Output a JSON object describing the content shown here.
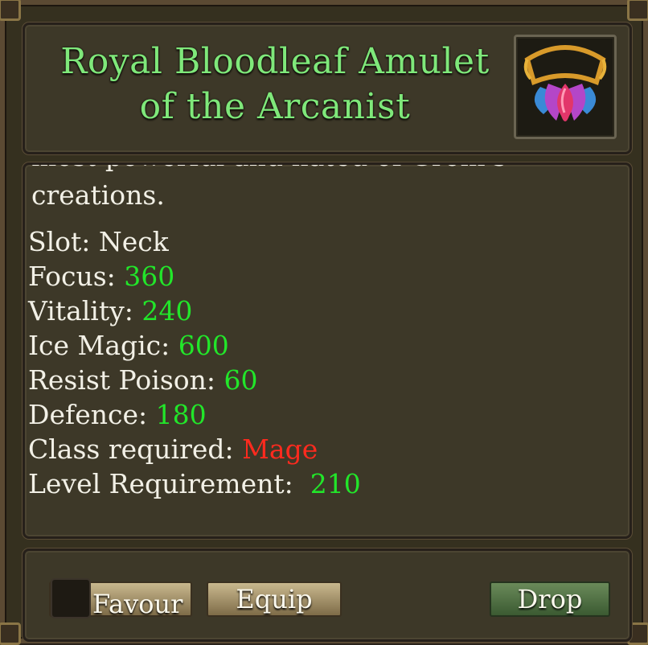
{
  "item": {
    "name_line1": "Royal Bloodleaf Amulet",
    "name_line2": "of the Arcanist",
    "icon": "amulet-icon",
    "description_cut": "most powerful and hated of Grom's",
    "description_end": "creations."
  },
  "stats": [
    {
      "label": "Slot: ",
      "value": "Neck",
      "color": "#f2f0e6"
    },
    {
      "label": "Focus: ",
      "value": "360",
      "color": "#22e62a"
    },
    {
      "label": "Vitality: ",
      "value": "240",
      "color": "#22e62a"
    },
    {
      "label": "Ice Magic: ",
      "value": "600",
      "color": "#22e62a"
    },
    {
      "label": "Resist Poison: ",
      "value": "60",
      "color": "#22e62a"
    },
    {
      "label": "Defence: ",
      "value": "180",
      "color": "#22e62a"
    },
    {
      "label": "Class required: ",
      "value": "Mage",
      "color": "#ff2a1e"
    },
    {
      "label": "Level Requirement:  ",
      "value": "210",
      "color": "#22e62a"
    }
  ],
  "buttons": {
    "favour": "Favour",
    "equip": "Equip",
    "drop": "Drop"
  }
}
